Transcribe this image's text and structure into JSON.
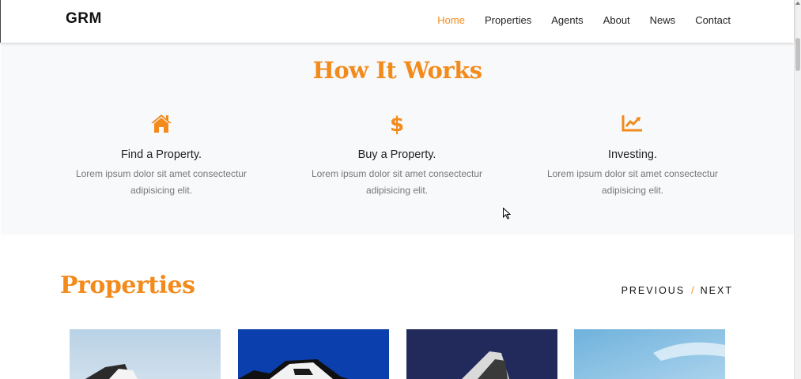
{
  "header": {
    "brand": "GRM",
    "nav": [
      "Home",
      "Properties",
      "Agents",
      "About",
      "News",
      "Contact"
    ],
    "active": "Home"
  },
  "how_it_works": {
    "title": "How It Works",
    "features": [
      {
        "icon": "home-icon",
        "title": "Find a Property.",
        "line1": "Lorem ipsum dolor sit amet consectectur",
        "line2": "adipisicing elit."
      },
      {
        "icon": "dollar-icon",
        "title": "Buy a Property.",
        "line1": "Lorem ipsum dolor sit amet consectectur",
        "line2": "adipisicing elit."
      },
      {
        "icon": "chart-line-icon",
        "title": "Investing.",
        "line1": "Lorem ipsum dolor sit amet consectectur",
        "line2": "adipisicing elit."
      }
    ]
  },
  "properties": {
    "title": "Properties",
    "previous": "PREVIOUS",
    "separator": "/",
    "next": "NEXT"
  },
  "colors": {
    "accent": "#f28b1c",
    "section_bg": "#f8f9fa"
  }
}
